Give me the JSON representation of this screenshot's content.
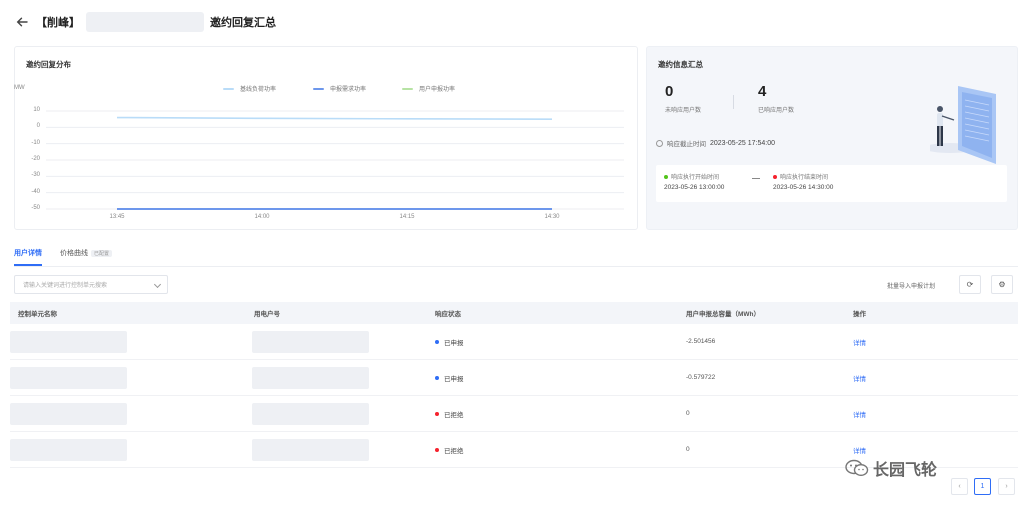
{
  "header": {
    "title_prefix": "【削峰】",
    "title_suffix": "邀约回复汇总"
  },
  "chart_card": {
    "title": "邀约回复分布",
    "unit": "MW",
    "legend": [
      {
        "label": "基线负荷功率",
        "color": "#b9dcf8"
      },
      {
        "label": "申报需求功率",
        "color": "#6d97ec"
      },
      {
        "label": "用户申报功率",
        "color": "#b7e3a4"
      }
    ]
  },
  "chart_data": {
    "type": "line",
    "x": [
      "13:45",
      "14:00",
      "14:15",
      "14:30"
    ],
    "y_ticks": [
      10,
      0,
      -10,
      -20,
      -30,
      -40,
      -50
    ],
    "ylim": [
      -50,
      10
    ],
    "grid": true,
    "legend_position": "top-right",
    "series": [
      {
        "name": "基线负荷功率",
        "values": [
          6,
          5.5,
          5.2,
          5
        ],
        "color": "#b9dcf8"
      },
      {
        "name": "申报需求功率",
        "values": [
          -50,
          -50,
          -50,
          -50
        ],
        "color": "#6d97ec"
      }
    ]
  },
  "summary": {
    "title": "邀约信息汇总",
    "stats": [
      {
        "value": "0",
        "label": "未响应用户数"
      },
      {
        "value": "4",
        "label": "已响应用户数"
      }
    ],
    "deadline_label": "响应截止时间",
    "deadline_value": "2023-05-25 17:54:00",
    "start_label": "响应执行开始时间",
    "start_value": "2023-05-26 13:00:00",
    "start_color": "#52c41a",
    "end_label": "响应执行结束时间",
    "end_value": "2023-05-26 14:30:00",
    "end_color": "#f5222d"
  },
  "tabs": [
    {
      "label": "用户详情",
      "active": true
    },
    {
      "label": "价格曲线",
      "badge": "已配置",
      "active": false
    }
  ],
  "toolbar": {
    "search_placeholder": "请输入关键词进行控制单元搜索",
    "import_label": "批量导入申报计划",
    "refresh_icon": "⟳",
    "settings_icon": "⚙"
  },
  "table": {
    "columns": [
      "控制单元名称",
      "用电户号",
      "响应状态",
      "用户申报总容量（MWh）",
      "操作"
    ],
    "rows": [
      {
        "status": "已申报",
        "status_color": "#2f6df6",
        "capacity": "-2.501456",
        "action": "详情"
      },
      {
        "status": "已申报",
        "status_color": "#2f6df6",
        "capacity": "-0.579722",
        "action": "详情"
      },
      {
        "status": "已拒绝",
        "status_color": "#f5222d",
        "capacity": "0",
        "action": "详情"
      },
      {
        "status": "已拒绝",
        "status_color": "#f5222d",
        "capacity": "0",
        "action": "详情"
      }
    ]
  },
  "watermark": "长园飞轮",
  "pagination": {
    "prev": "‹",
    "current": "1",
    "next": "›"
  }
}
